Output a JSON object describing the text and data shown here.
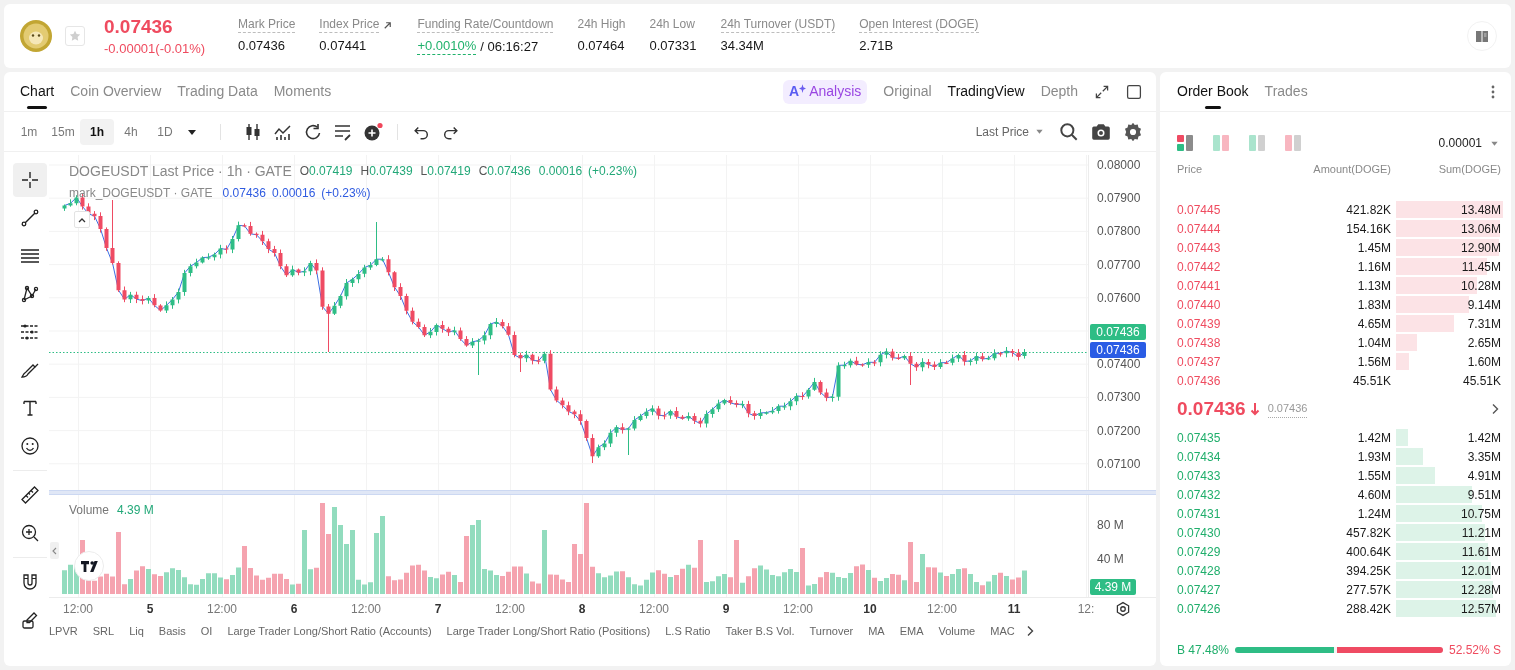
{
  "header": {
    "price": "0.07436",
    "change": "-0.00001(-0.01%)",
    "favorite": false,
    "stats": [
      {
        "label": "Mark Price",
        "value": "0.07436",
        "kind": "plain",
        "underlined": true
      },
      {
        "label": "Index Price",
        "value": "0.07441",
        "kind": "link",
        "underlined": true
      },
      {
        "label": "Funding Rate/Countdown",
        "value": "+0.0010%",
        "countdown": "/ 06:16:27",
        "kind": "funding",
        "underlined": true
      },
      {
        "label": "24h High",
        "value": "0.07464",
        "kind": "plain",
        "underlined": false
      },
      {
        "label": "24h Low",
        "value": "0.07331",
        "kind": "plain",
        "underlined": false
      },
      {
        "label": "24h Turnover (USDT)",
        "value": "34.34M",
        "kind": "plain",
        "underlined": true
      },
      {
        "label": "Open Interest (DOGE)",
        "value": "2.71B",
        "kind": "plain",
        "underlined": true
      }
    ]
  },
  "chart_panel": {
    "tabs": [
      {
        "label": "Chart",
        "selected": true
      },
      {
        "label": "Coin Overview",
        "selected": false
      },
      {
        "label": "Trading Data",
        "selected": false
      },
      {
        "label": "Moments",
        "selected": false
      }
    ],
    "view_modes": [
      {
        "label": "Analysis",
        "badge": "A",
        "kind": "ai",
        "selected": false
      },
      {
        "label": "Original",
        "kind": "view",
        "selected": false
      },
      {
        "label": "TradingView",
        "kind": "view",
        "selected": true
      },
      {
        "label": "Depth",
        "kind": "view",
        "selected": false
      }
    ],
    "intervals": [
      {
        "label": "1m",
        "selected": false
      },
      {
        "label": "15m",
        "selected": false
      },
      {
        "label": "1h",
        "selected": true
      },
      {
        "label": "4h",
        "selected": false
      },
      {
        "label": "1D",
        "selected": false
      }
    ],
    "price_source": "Last Price",
    "drawing_tools": [
      {
        "selected": true
      },
      {
        "selected": false
      },
      {
        "selected": false
      },
      {
        "selected": false
      },
      {
        "selected": false
      },
      {
        "selected": false
      },
      {
        "selected": false
      },
      {
        "selected": false
      },
      {
        "selected": false
      },
      {
        "selected": false
      },
      {
        "selected": false
      },
      {
        "selected": false
      }
    ],
    "legend": {
      "title": "DOGEUSDT Last Price · 1h · GATE",
      "ohlc": [
        {
          "key": "O",
          "value": "0.07419"
        },
        {
          "key": "H",
          "value": "0.07439"
        },
        {
          "key": "L",
          "value": "0.07419"
        },
        {
          "key": "C",
          "value": "0.07436"
        }
      ],
      "change": "0.00016",
      "change_pct": "(+0.23%)",
      "mark_title": "mark_DOGEUSDT · GATE",
      "mark_values": [
        "0.07436",
        "0.00016",
        "(+0.23%)"
      ]
    },
    "price_axis": [
      "0.08000",
      "0.07900",
      "0.07800",
      "0.07700",
      "0.07600",
      "0.07400",
      "0.07300",
      "0.07200",
      "0.07100"
    ],
    "last_price_tag": "0.07436",
    "mark_price_tag": "0.07436",
    "volume": {
      "label": "Volume",
      "value": "4.39 M",
      "axis": [
        "80 M",
        "40 M"
      ],
      "tag": "4.39 M"
    },
    "time_axis": [
      {
        "label": "12:00",
        "kind": "time"
      },
      {
        "label": "5",
        "kind": "day"
      },
      {
        "label": "12:00",
        "kind": "time"
      },
      {
        "label": "6",
        "kind": "day"
      },
      {
        "label": "12:00",
        "kind": "time"
      },
      {
        "label": "7",
        "kind": "day"
      },
      {
        "label": "12:00",
        "kind": "time"
      },
      {
        "label": "8",
        "kind": "day"
      },
      {
        "label": "12:00",
        "kind": "time"
      },
      {
        "label": "9",
        "kind": "day"
      },
      {
        "label": "12:00",
        "kind": "time"
      },
      {
        "label": "10",
        "kind": "day"
      },
      {
        "label": "12:00",
        "kind": "time"
      },
      {
        "label": "11",
        "kind": "day"
      },
      {
        "label": "12:",
        "kind": "time"
      }
    ],
    "indicators": [
      "LPVR",
      "SRL",
      "Liq",
      "Basis",
      "OI",
      "Large Trader Long/Short Ratio (Accounts)",
      "Large Trader Long/Short Ratio (Positions)",
      "L.S Ratio",
      "Taker B.S Vol.",
      "Turnover",
      "MA",
      "EMA",
      "Volume",
      "MAC"
    ]
  },
  "order_book": {
    "tabs": [
      {
        "label": "Order Book",
        "selected": true
      },
      {
        "label": "Trades",
        "selected": false
      }
    ],
    "layouts": [
      {
        "selected": true
      },
      {
        "selected": false
      },
      {
        "selected": false
      },
      {
        "selected": false
      }
    ],
    "precision": "0.00001",
    "columns": [
      "Price",
      "Amount(DOGE)",
      "Sum(DOGE)"
    ],
    "asks": [
      {
        "price": "0.07445",
        "amount": "421.82K",
        "sum": "13.48M",
        "level": 1.0
      },
      {
        "price": "0.07444",
        "amount": "154.16K",
        "sum": "13.06M",
        "level": 0.97
      },
      {
        "price": "0.07443",
        "amount": "1.45M",
        "sum": "12.90M",
        "level": 0.96
      },
      {
        "price": "0.07442",
        "amount": "1.16M",
        "sum": "11.45M",
        "level": 0.85
      },
      {
        "price": "0.07441",
        "amount": "1.13M",
        "sum": "10.28M",
        "level": 0.76
      },
      {
        "price": "0.07440",
        "amount": "1.83M",
        "sum": "9.14M",
        "level": 0.68
      },
      {
        "price": "0.07439",
        "amount": "4.65M",
        "sum": "7.31M",
        "level": 0.54
      },
      {
        "price": "0.07438",
        "amount": "1.04M",
        "sum": "2.65M",
        "level": 0.2
      },
      {
        "price": "0.07437",
        "amount": "1.56M",
        "sum": "1.60M",
        "level": 0.12
      },
      {
        "price": "0.07436",
        "amount": "45.51K",
        "sum": "45.51K"
      }
    ],
    "last_price": "0.07436",
    "mark_price": "0.07436",
    "bids": [
      {
        "price": "0.07435",
        "amount": "1.42M",
        "sum": "1.42M",
        "level": 0.11
      },
      {
        "price": "0.07434",
        "amount": "1.93M",
        "sum": "3.35M",
        "level": 0.25
      },
      {
        "price": "0.07433",
        "amount": "1.55M",
        "sum": "4.91M",
        "level": 0.36
      },
      {
        "price": "0.07432",
        "amount": "4.60M",
        "sum": "9.51M",
        "level": 0.71
      },
      {
        "price": "0.07431",
        "amount": "1.24M",
        "sum": "10.75M",
        "level": 0.8
      },
      {
        "price": "0.07430",
        "amount": "457.82K",
        "sum": "11.21M",
        "level": 0.83
      },
      {
        "price": "0.07429",
        "amount": "400.64K",
        "sum": "11.61M",
        "level": 0.86
      },
      {
        "price": "0.07428",
        "amount": "394.25K",
        "sum": "12.01M",
        "level": 0.89
      },
      {
        "price": "0.07427",
        "amount": "277.57K",
        "sum": "12.28M",
        "level": 0.91
      },
      {
        "price": "0.07426",
        "amount": "288.42K",
        "sum": "12.57M",
        "level": 0.93
      }
    ],
    "ratio": {
      "buy": "B 47.48%",
      "sell": "52.52% S",
      "level": 0.4748
    }
  }
}
